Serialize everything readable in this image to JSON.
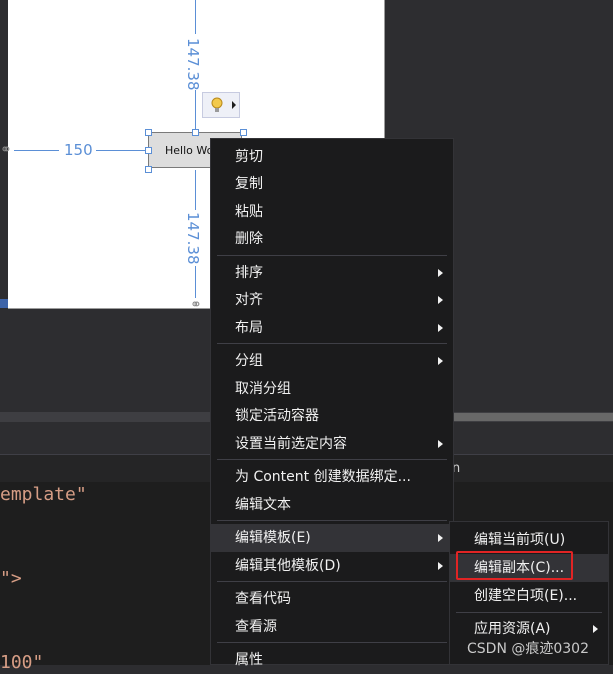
{
  "designer": {
    "button_text": "Hello Wo",
    "dim_top": "147.38",
    "dim_left": "150",
    "dim_bottom": "147.38"
  },
  "editor": {
    "line1": "emplate\"",
    "line2": "\">",
    "line3": "100\"",
    "tab_partial": "n"
  },
  "context_menu": {
    "items": [
      {
        "label": "剪切",
        "has_submenu": false
      },
      {
        "label": "复制",
        "has_submenu": false
      },
      {
        "label": "粘贴",
        "has_submenu": false
      },
      {
        "label": "删除",
        "has_submenu": false
      },
      {
        "label": "排序",
        "has_submenu": true
      },
      {
        "label": "对齐",
        "has_submenu": true
      },
      {
        "label": "布局",
        "has_submenu": true
      },
      {
        "label": "分组",
        "has_submenu": true
      },
      {
        "label": "取消分组",
        "has_submenu": false
      },
      {
        "label": "锁定活动容器",
        "has_submenu": false
      },
      {
        "label": "设置当前选定内容",
        "has_submenu": true
      },
      {
        "label": "为 Content 创建数据绑定...",
        "has_submenu": false
      },
      {
        "label": "编辑文本",
        "has_submenu": false
      },
      {
        "label": "编辑模板(E)",
        "has_submenu": true,
        "highlighted": true
      },
      {
        "label": "编辑其他模板(D)",
        "has_submenu": true
      },
      {
        "label": "查看代码",
        "has_submenu": false
      },
      {
        "label": "查看源",
        "has_submenu": false
      },
      {
        "label": "属性",
        "has_submenu": false
      }
    ]
  },
  "submenu": {
    "items": [
      {
        "label": "编辑当前项(U)"
      },
      {
        "label": "编辑副本(C)..."
      },
      {
        "label": "创建空白项(E)..."
      },
      {
        "label": "应用资源(A)"
      }
    ]
  },
  "watermark": "CSDN @痕迹0302",
  "colors": {
    "accent_blue": "#5b8fd6",
    "highlight_red": "#e12424",
    "menu_bg": "#1b1b1c"
  }
}
